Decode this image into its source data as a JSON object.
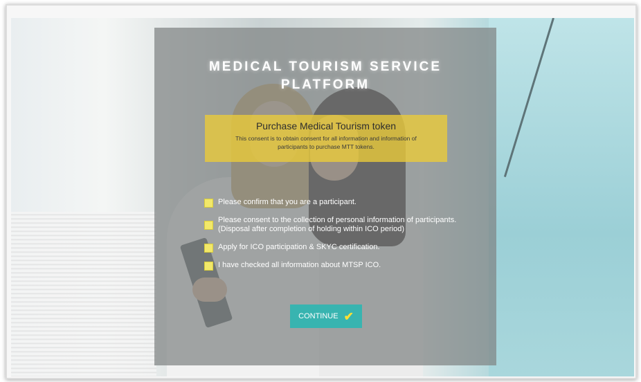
{
  "page": {
    "title_line1": "MEDICAL TOURISM SERVICE",
    "title_line2": "PLATFORM"
  },
  "token": {
    "heading": "Purchase Medical Tourism token",
    "description": "This consent is to obtain consent for all information and information of participants to purchase MTT tokens."
  },
  "consents": [
    {
      "label": "Please confirm that you are a participant."
    },
    {
      "label": "Please consent to the collection of personal information of participants. (Disposal after completion of holding within ICO period)"
    },
    {
      "label": "Apply for ICO participation & SKYC certification."
    },
    {
      "label": "I have checked all information about MTSP ICO."
    }
  ],
  "actions": {
    "continue_label": "CONTINUE",
    "continue_icon": "checkmark-icon"
  },
  "colors": {
    "accent_yellow": "#ecc838",
    "button_teal": "#38b4b0",
    "check_yellow": "#ffe033"
  }
}
